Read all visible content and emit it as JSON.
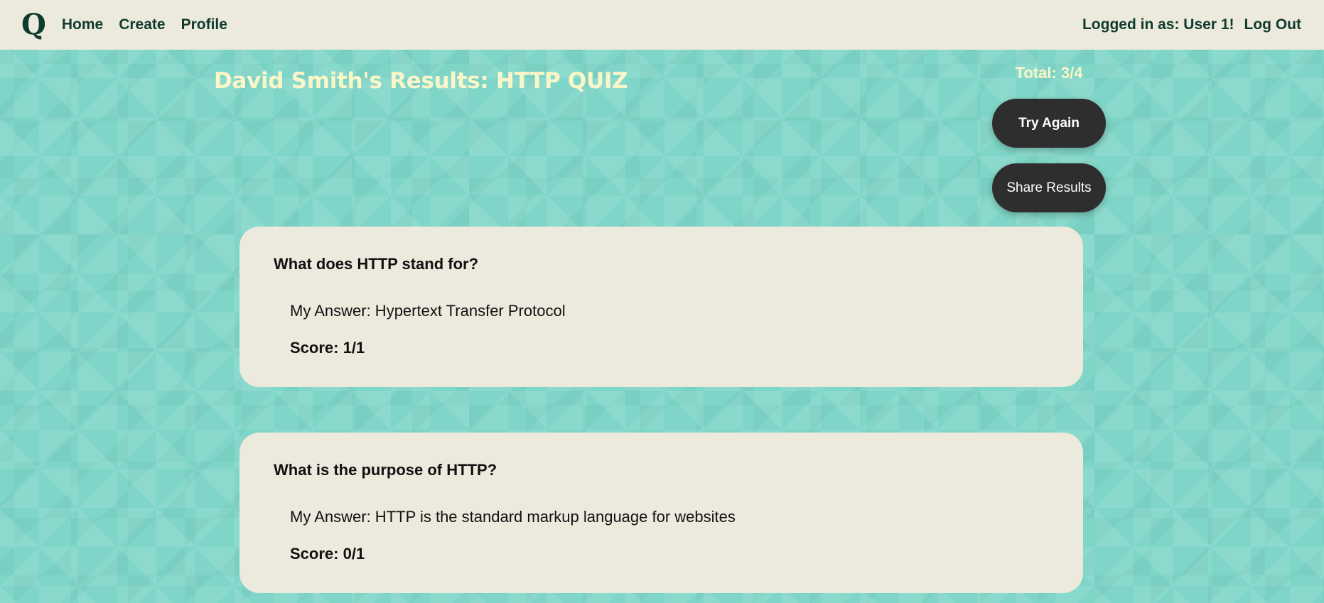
{
  "nav": {
    "logo": "Q",
    "links": [
      "Home",
      "Create",
      "Profile"
    ],
    "user_label": "Logged in as: User 1!",
    "logout_label": "Log Out"
  },
  "results": {
    "title": "David Smith's Results: HTTP QUIZ",
    "total": "Total: 3/4",
    "try_again_label": "Try Again",
    "share_label": "Share Results"
  },
  "questions": [
    {
      "question": "What does HTTP stand for?",
      "answer": "My Answer: Hypertext Transfer Protocol",
      "score": "Score: 1/1"
    },
    {
      "question": "What is the purpose of HTTP?",
      "answer": "My Answer: HTTP is the standard markup language for websites",
      "score": "Score: 0/1"
    }
  ],
  "colors": {
    "nav_bg": "#ece9dd",
    "nav_text": "#0f3b2c",
    "page_bg": "#7fd6c8",
    "title_text": "#fbf6c8",
    "button_bg": "#2e2e2e",
    "card_bg": "#ece9dd"
  }
}
